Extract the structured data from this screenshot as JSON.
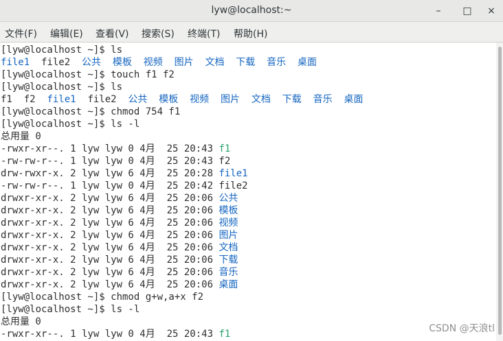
{
  "window": {
    "title": "lyw@localhost:~",
    "minimize_glyph": "–",
    "maximize_glyph": "□",
    "close_glyph": "×"
  },
  "menu": [
    {
      "name": "menu-file",
      "label": "文件(F)"
    },
    {
      "name": "menu-edit",
      "label": "编辑(E)"
    },
    {
      "name": "menu-view",
      "label": "查看(V)"
    },
    {
      "name": "menu-search",
      "label": "搜索(S)"
    },
    {
      "name": "menu-terminal",
      "label": "终端(T)"
    },
    {
      "name": "menu-help",
      "label": "帮助(H)"
    }
  ],
  "colors": {
    "default": "#2e2e2e",
    "blue": "#1565c0",
    "green": "#26a269"
  },
  "terminal": {
    "lines": [
      {
        "segments": [
          {
            "t": "[lyw@localhost ~]$ ls",
            "c": "default"
          }
        ]
      },
      {
        "segments": [
          {
            "t": "file1",
            "c": "blue"
          },
          {
            "t": "  file2  ",
            "c": "default"
          },
          {
            "t": "公共  模板  视频  图片  文档  下载  音乐  桌面",
            "c": "blue"
          }
        ]
      },
      {
        "segments": [
          {
            "t": "[lyw@localhost ~]$ touch f1 f2",
            "c": "default"
          }
        ]
      },
      {
        "segments": [
          {
            "t": "[lyw@localhost ~]$ ls",
            "c": "default"
          }
        ]
      },
      {
        "segments": [
          {
            "t": "f1  f2  ",
            "c": "default"
          },
          {
            "t": "file1",
            "c": "blue"
          },
          {
            "t": "  file2  ",
            "c": "default"
          },
          {
            "t": "公共  模板  视频  图片  文档  下载  音乐  桌面",
            "c": "blue"
          }
        ]
      },
      {
        "segments": [
          {
            "t": "[lyw@localhost ~]$ chmod 754 f1",
            "c": "default"
          }
        ]
      },
      {
        "segments": [
          {
            "t": "[lyw@localhost ~]$ ls -l",
            "c": "default"
          }
        ]
      },
      {
        "segments": [
          {
            "t": "总用量 0",
            "c": "default"
          }
        ]
      },
      {
        "segments": [
          {
            "t": "-rwxr-xr--. 1 lyw lyw 0 4月  25 20:43 ",
            "c": "default"
          },
          {
            "t": "f1",
            "c": "green"
          }
        ]
      },
      {
        "segments": [
          {
            "t": "-rw-rw-r--. 1 lyw lyw 0 4月  25 20:43 f2",
            "c": "default"
          }
        ]
      },
      {
        "segments": [
          {
            "t": "drw-rwxr-x. 2 lyw lyw 6 4月  25 20:28 ",
            "c": "default"
          },
          {
            "t": "file1",
            "c": "blue"
          }
        ]
      },
      {
        "segments": [
          {
            "t": "-rw-rw-r--. 1 lyw lyw 0 4月  25 20:42 file2",
            "c": "default"
          }
        ]
      },
      {
        "segments": [
          {
            "t": "drwxr-xr-x. 2 lyw lyw 6 4月  25 20:06 ",
            "c": "default"
          },
          {
            "t": "公共",
            "c": "blue"
          }
        ]
      },
      {
        "segments": [
          {
            "t": "drwxr-xr-x. 2 lyw lyw 6 4月  25 20:06 ",
            "c": "default"
          },
          {
            "t": "模板",
            "c": "blue"
          }
        ]
      },
      {
        "segments": [
          {
            "t": "drwxr-xr-x. 2 lyw lyw 6 4月  25 20:06 ",
            "c": "default"
          },
          {
            "t": "视频",
            "c": "blue"
          }
        ]
      },
      {
        "segments": [
          {
            "t": "drwxr-xr-x. 2 lyw lyw 6 4月  25 20:06 ",
            "c": "default"
          },
          {
            "t": "图片",
            "c": "blue"
          }
        ]
      },
      {
        "segments": [
          {
            "t": "drwxr-xr-x. 2 lyw lyw 6 4月  25 20:06 ",
            "c": "default"
          },
          {
            "t": "文档",
            "c": "blue"
          }
        ]
      },
      {
        "segments": [
          {
            "t": "drwxr-xr-x. 2 lyw lyw 6 4月  25 20:06 ",
            "c": "default"
          },
          {
            "t": "下载",
            "c": "blue"
          }
        ]
      },
      {
        "segments": [
          {
            "t": "drwxr-xr-x. 2 lyw lyw 6 4月  25 20:06 ",
            "c": "default"
          },
          {
            "t": "音乐",
            "c": "blue"
          }
        ]
      },
      {
        "segments": [
          {
            "t": "drwxr-xr-x. 2 lyw lyw 6 4月  25 20:06 ",
            "c": "default"
          },
          {
            "t": "桌面",
            "c": "blue"
          }
        ]
      },
      {
        "segments": [
          {
            "t": "[lyw@localhost ~]$ chmod g+w,a+x f2",
            "c": "default"
          }
        ]
      },
      {
        "segments": [
          {
            "t": "[lyw@localhost ~]$ ls -l",
            "c": "default"
          }
        ]
      },
      {
        "segments": [
          {
            "t": "总用量 0",
            "c": "default"
          }
        ]
      },
      {
        "segments": [
          {
            "t": "-rwxr-xr--. 1 lyw lyw 0 4月  25 20:43 ",
            "c": "default"
          },
          {
            "t": "f1",
            "c": "green"
          }
        ]
      }
    ]
  },
  "watermark": "CSDN @天浪tl"
}
